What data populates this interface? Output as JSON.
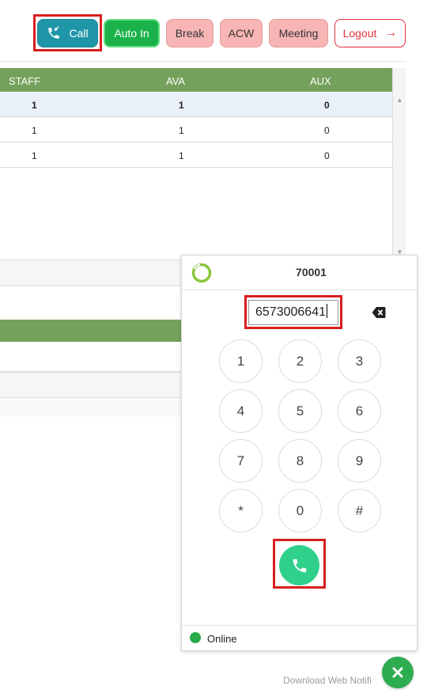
{
  "toolbar": {
    "call_label": "Call",
    "autoin_label": "Auto In",
    "break_label": "Break",
    "acw_label": "ACW",
    "meeting_label": "Meeting",
    "logout_label": "Logout"
  },
  "stats_table": {
    "columns": [
      "STAFF",
      "AVA",
      "AUX"
    ],
    "rows": [
      {
        "staff": "1",
        "ava": "1",
        "aux": "0"
      },
      {
        "staff": "1",
        "ava": "1",
        "aux": "0"
      },
      {
        "staff": "1",
        "ava": "1",
        "aux": "0"
      }
    ]
  },
  "dialer": {
    "extension": "70001",
    "number_value": "6573006641",
    "keys": [
      "1",
      "2",
      "3",
      "4",
      "5",
      "6",
      "7",
      "8",
      "9",
      "*",
      "0",
      "#"
    ],
    "status": "Online"
  },
  "footer": {
    "notification_text": "Download Web Notifi"
  },
  "colors": {
    "call_button": "#1f96a8",
    "auto_in": "#1bb24b",
    "status_buttons": "#f7b5b5",
    "logout": "#e0323a",
    "table_header": "#74a15c",
    "dial_call": "#2fd08a",
    "online": "#2aaa4a",
    "highlight": "#d81e1e"
  }
}
